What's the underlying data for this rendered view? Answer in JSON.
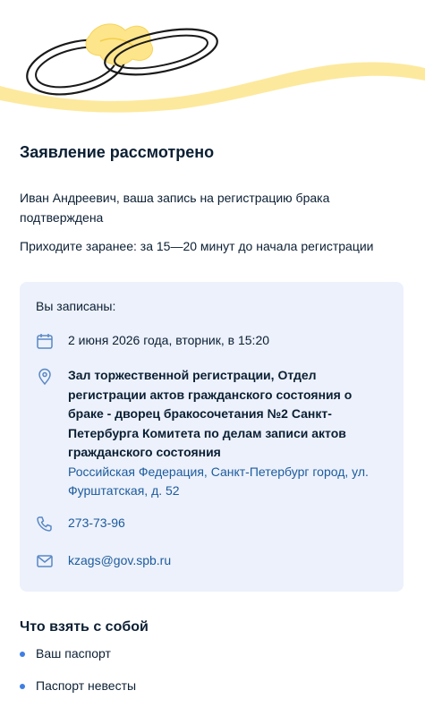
{
  "header": {
    "illustration": "wedding-rings-ribbon",
    "accent_color": "#fde58c"
  },
  "status": {
    "title": "Заявление рассмотрено",
    "message": "Иван Андреевич, ваша запись на регистрацию брака подтверждена",
    "advice": "Приходите заранее: за 15—20 минут до начала регистрации"
  },
  "booking": {
    "heading": "Вы записаны:",
    "date_icon": "calendar-icon",
    "date_text": "2 июня 2026 года, вторник, в 15:20",
    "place_icon": "location-pin-icon",
    "place_name": "Зал торжественной регистрации, Отдел регистрации актов гражданского состояния о браке - дворец бракосочетания №2 Санкт-Петербурга Комитета по делам записи актов гражданского состояния",
    "place_address": "Российская Федерация, Санкт-Петербург город, ул. Фурштатская, д. 52",
    "phone_icon": "phone-icon",
    "phone": "273-73-96",
    "email_icon": "mail-icon",
    "email": "kzags@gov.spb.ru",
    "card_color": "#ecf1fb"
  },
  "bring": {
    "title": "Что взять с собой",
    "items": [
      "Ваш паспорт",
      "Паспорт невесты"
    ]
  }
}
